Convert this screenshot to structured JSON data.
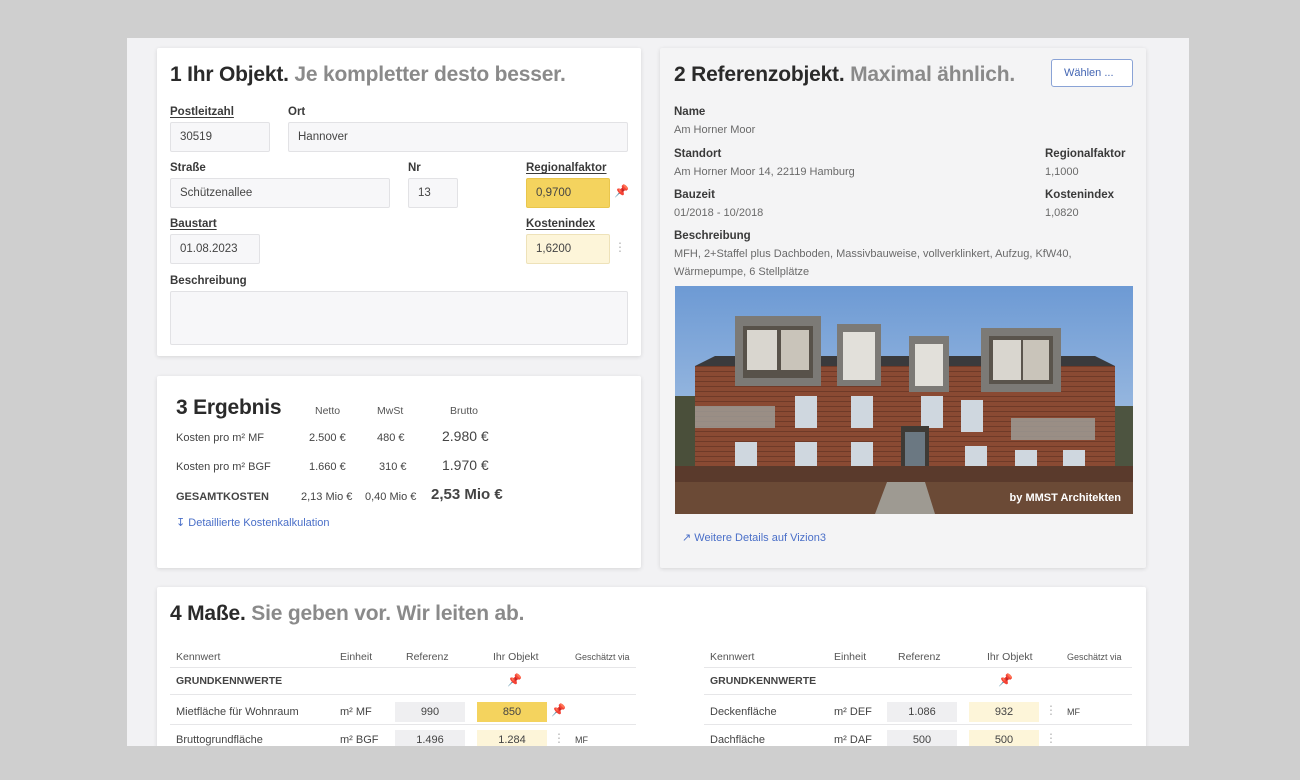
{
  "section1": {
    "title_bold": "1 Ihr Objekt.",
    "title_sub": "Je kompletter desto besser.",
    "postleitzahl_label": "Postleitzahl",
    "postleitzahl_value": "30519",
    "ort_label": "Ort",
    "ort_value": "Hannover",
    "strasse_label": "Straße",
    "strasse_value": "Schützenallee",
    "nr_label": "Nr",
    "nr_value": "13",
    "regionalfaktor_label": "Regionalfaktor",
    "regionalfaktor_value": "0,9700",
    "baustart_label": "Baustart",
    "baustart_value": "01.08.2023",
    "kostenindex_label": "Kostenindex",
    "kostenindex_value": "1,6200",
    "beschreibung_label": "Beschreibung",
    "beschreibung_value": ""
  },
  "section2": {
    "title_bold": "2 Referenzobjekt.",
    "title_sub": "Maximal ähnlich.",
    "choose_button": "Wählen ...",
    "name_label": "Name",
    "name_value": "Am Horner Moor",
    "standort_label": "Standort",
    "standort_value": "Am Horner Moor 14, 22119 Hamburg",
    "regionalfaktor_label": "Regionalfaktor",
    "regionalfaktor_value": "1,1000",
    "bauzeit_label": "Bauzeit",
    "bauzeit_value": "01/2018 - 10/2018",
    "kostenindex_label": "Kostenindex",
    "kostenindex_value": "1,0820",
    "beschreibung_label": "Beschreibung",
    "beschreibung_line1": "MFH, 2+Staffel plus Dachboden, Massivbauweise, vollverklinkert, Aufzug, KfW40,",
    "beschreibung_line2": "Wärmepumpe, 6 Stellplätze",
    "photo_credit": "by MMST Architekten",
    "details_link": "Weitere Details auf Vizion3"
  },
  "section3": {
    "title": "3 Ergebnis",
    "col_netto": "Netto",
    "col_mwst": "MwSt",
    "col_brutto": "Brutto",
    "rows": [
      {
        "label": "Kosten pro m² MF",
        "netto": "2.500 €",
        "mwst": "480 €",
        "brutto": "2.980 €"
      },
      {
        "label": "Kosten pro m² BGF",
        "netto": "1.660 €",
        "mwst": "310 €",
        "brutto": "1.970 €"
      },
      {
        "label": "GESAMTKOSTEN",
        "netto": "2,13 Mio €",
        "mwst": "0,40 Mio €",
        "brutto": "2,53 Mio €"
      }
    ],
    "details_link": "Detaillierte Kostenkalkulation"
  },
  "section4": {
    "title_bold": "4 Maße.",
    "title_sub": "Sie geben vor. Wir leiten ab.",
    "headers": {
      "kennwert": "Kennwert",
      "einheit": "Einheit",
      "referenz": "Referenz",
      "ihr_objekt": "Ihr Objekt",
      "geschaetzt": "Geschätzt via"
    },
    "group_label": "GRUNDKENNWERTE",
    "left_rows": [
      {
        "kennwert": "Mietfläche für Wohnraum",
        "einheit": "m² MF",
        "referenz": "990",
        "ihr_objekt": "850",
        "via": ""
      },
      {
        "kennwert": "Bruttogrundfläche",
        "einheit": "m² BGF",
        "referenz": "1.496",
        "ihr_objekt": "1.284",
        "via": "MF"
      }
    ],
    "right_rows": [
      {
        "kennwert": "Deckenfläche",
        "einheit": "m² DEF",
        "referenz": "1.086",
        "ihr_objekt": "932",
        "via": "MF"
      },
      {
        "kennwert": "Dachfläche",
        "einheit": "m² DAF",
        "referenz": "500",
        "ihr_objekt": "500",
        "via": ""
      }
    ]
  }
}
